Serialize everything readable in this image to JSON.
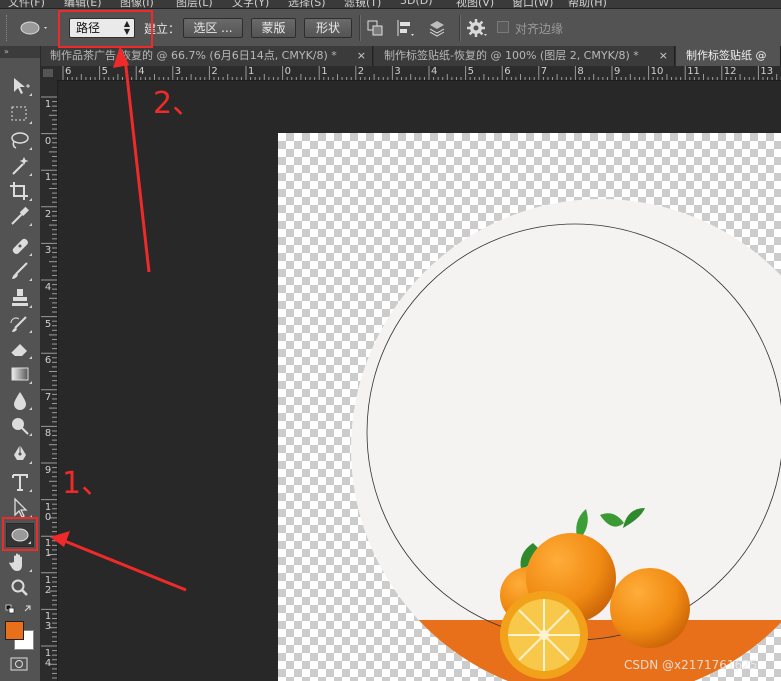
{
  "menubar": {
    "items": [
      "文件(F)",
      "编辑(E)",
      "图像(I)",
      "图层(L)",
      "文字(Y)",
      "选择(S)",
      "滤镜(T)",
      "3D(D)",
      "视图(V)",
      "窗口(W)",
      "帮助(H)"
    ]
  },
  "options_bar": {
    "mode_select_value": "路径",
    "make_label": "建立：",
    "selection_button": "选区 ...",
    "mask_button": "蒙版",
    "shape_button": "形状",
    "align_edges_label": "对齐边缘",
    "align_edges_checked": false
  },
  "tabs": [
    {
      "label": "制作品茶广告-恢复的 @ 66.7% (6月6日14点, CMYK/8) *",
      "close": "×",
      "active": false
    },
    {
      "label": "制作标签贴纸-恢复的 @ 100% (图层 2, CMYK/8) *",
      "close": "×",
      "active": false
    },
    {
      "label": "制作标签贴纸 @",
      "close": "",
      "active": true
    }
  ],
  "ruler_top_labels": [
    "6",
    "5",
    "4",
    "3",
    "2",
    "1",
    "0",
    "1",
    "2",
    "3",
    "4",
    "5",
    "6",
    "7",
    "8",
    "9",
    "10",
    "11",
    "12",
    "13"
  ],
  "ruler_left_labels": [
    "1",
    "0",
    "1",
    "2",
    "3",
    "4",
    "5",
    "6",
    "7",
    "8",
    "9",
    "1 0",
    "1 1",
    "1 2",
    "1 3",
    "1 4"
  ],
  "toolbox": {
    "header": "»",
    "tools": [
      "move-tool",
      "rectangular-marquee-tool",
      "lasso-tool",
      "quick-selection-tool",
      "crop-tool",
      "eyedropper-tool",
      "spot-healing-brush-tool",
      "brush-tool",
      "clone-stamp-tool",
      "history-brush-tool",
      "eraser-tool",
      "gradient-tool",
      "blur-tool",
      "dodge-tool",
      "pen-tool",
      "type-tool",
      "path-selection-tool",
      "ellipse-tool",
      "hand-tool",
      "zoom-tool"
    ],
    "active_tool": "ellipse-tool",
    "foreground_color": "#e8701a",
    "background_color": "#ffffff"
  },
  "annotations": {
    "label_1": "1、",
    "label_2": "2、",
    "color": "#ee2a2a"
  },
  "watermark": "CSDN @x2171761625",
  "colors": {
    "accent_orange": "#e8701a",
    "plate": "#f5f2f2",
    "annotation_red": "#ee2a2a"
  }
}
